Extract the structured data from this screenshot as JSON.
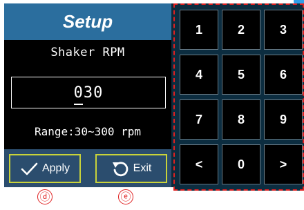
{
  "title": "Setup",
  "parameter_label": "Shaker RPM",
  "value": "030",
  "range": "Range:30~300 rpm",
  "actions": {
    "apply_label": "Apply",
    "exit_label": "Exit",
    "apply_icon": "checkmark-icon",
    "exit_icon": "undo-arrow-icon"
  },
  "keypad": {
    "keys": [
      "1",
      "2",
      "3",
      "4",
      "5",
      "6",
      "7",
      "8",
      "9",
      "<",
      "0",
      ">"
    ]
  },
  "markers": {
    "d": "ⓓ",
    "e": "ⓔ"
  },
  "colors": {
    "title_bar": "#2b6e9e",
    "action_bar": "#2b4d6e",
    "button_border": "#c9d33a",
    "keypad_bg": "#0c2d40",
    "highlight": "#e02020"
  }
}
